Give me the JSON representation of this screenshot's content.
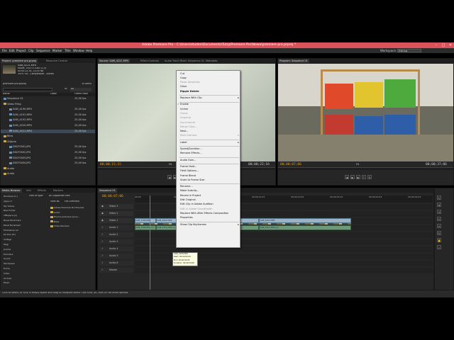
{
  "app": {
    "title": "Adobe Premiere Pro - C:\\Users\\studen\\Documents\\Tutaj\\Premiere Pro\\Nowa\\premiere pro.prproj *",
    "window_controls": [
      "–",
      "□",
      "✕"
    ],
    "workspace_label": "Workspace:",
    "workspace_value": "Editing"
  },
  "menu": [
    "File",
    "Edit",
    "Project",
    "Clip",
    "Sequence",
    "Marker",
    "Title",
    "Window",
    "Help"
  ],
  "project_panel": {
    "tabs": [
      "Project: premiere pro.prproj",
      "Resource Central"
    ],
    "clip_info": {
      "name": "SAM_4221.MP4",
      "line1": "Movie, 1920 x 1080 (1.0)",
      "line2": "00:00:22:16, 25,00 fps",
      "line3": "29.97 Hz - Compressed - Stereo"
    },
    "project_name": "premiere pro.prproj",
    "item_count": "30 Items",
    "search_placeholder": "",
    "in_label": "In:",
    "in_value": "All",
    "col_name": "Name",
    "col_label": "Label",
    "col_rate": "Frame Rate",
    "items": [
      {
        "name": "Sequence 01",
        "rate": "25,00 fps",
        "type": "seq"
      },
      {
        "name": "Video Filmy",
        "rate": "",
        "type": "folder"
      },
      {
        "name": "SAM_4190.MP4",
        "rate": "25,00 fps",
        "type": "clip"
      },
      {
        "name": "SAM_4191.MP4",
        "rate": "25,00 fps",
        "type": "clip"
      },
      {
        "name": "SAM_4192.MP4",
        "rate": "25,00 fps",
        "type": "clip"
      },
      {
        "name": "SAM_4220.MP4",
        "rate": "25,00 fps",
        "type": "clip"
      },
      {
        "name": "SAM_4221.MP4",
        "rate": "25,00 fps",
        "type": "clip"
      },
      {
        "name": "Biles",
        "rate": "",
        "type": "folder"
      },
      {
        "name": "Zdjęcia",
        "rate": "",
        "type": "folder"
      },
      {
        "name": "DSCF0001.JPG",
        "rate": "25,00 fps",
        "type": "clip"
      },
      {
        "name": "DSCF0002.JPG",
        "rate": "25,00 fps",
        "type": "clip"
      },
      {
        "name": "DSCF0003.JPG",
        "rate": "25,00 fps",
        "type": "clip"
      },
      {
        "name": "DSCF0004.JPG",
        "rate": "25,00 fps",
        "type": "clip"
      },
      {
        "name": "Audio",
        "rate": "",
        "type": "folder"
      },
      {
        "name": "Audio",
        "rate": "",
        "type": "folder"
      }
    ]
  },
  "source_monitor": {
    "tabs": [
      "Source: SAM_4221.MP4",
      "Effect Controls",
      "Audio Track Mixer: Sequence 01",
      "Metadata"
    ],
    "timecode_in": "00;00;15;15",
    "timecode_out": "00;00;22;16",
    "fit_label": "Fit"
  },
  "program_monitor": {
    "tabs": [
      "Program: Sequence 01"
    ],
    "timecode_in": "00;00;07;06",
    "timecode_out": "00;00;37;06",
    "fit_label": "Fit"
  },
  "media_browser": {
    "tabs": [
      "Media Browser",
      "Info",
      "Effects",
      "Markers"
    ],
    "files_of_type_label": "Files of type:",
    "files_of_type_value": "All Supported Files",
    "view_as_label": "View as:",
    "view_as_value": "File Directory",
    "tree": [
      "Windows (C:)",
      "Apps.rcr",
      "My Videos",
      "New Folder",
      "offtspace.prj",
      "Nowa Bookmark",
      "Panel Bookmark",
      "Photoshop Ad",
      "Sh Kick (E:)",
      "Solfege",
      "Targi",
      "Joomla",
      "Premiere",
      "Sound",
      "Wordpress",
      "Home",
      "Video",
      "Archive",
      "Music"
    ],
    "files": [
      "Adobe Premiere Pro Preview",
      "Audio",
      "Encore premiere pro.p...",
      "Biles",
      "Video Renders"
    ]
  },
  "timeline": {
    "tabs": [
      "Sequence 01"
    ],
    "timecode": "00;00;07;06",
    "ruler": [
      "00;00",
      "00;00;04;23",
      "00;00;09;23",
      "00;00;14;23",
      "00;00;19;23",
      "00;00;24;23",
      "00;00;29;23",
      "00;00;34;23"
    ],
    "tracks": [
      {
        "name": "Video 3",
        "kind": "video"
      },
      {
        "name": "Video 2",
        "kind": "video"
      },
      {
        "name": "Video 1",
        "kind": "video"
      },
      {
        "name": "Audio 1",
        "kind": "audio"
      },
      {
        "name": "Audio 2",
        "kind": "audio"
      },
      {
        "name": "Audio 3",
        "kind": "audio"
      },
      {
        "name": "Audio 4",
        "kind": "audio"
      },
      {
        "name": "Audio 5",
        "kind": "audio"
      },
      {
        "name": "Audio 6",
        "kind": "audio"
      },
      {
        "name": "Master",
        "kind": "audio"
      }
    ],
    "clips_v1": [
      "SAM_4190.MP4",
      "SAM_4221.MP4",
      "SAM_4192.MP4",
      "SAM_4220.MP4",
      "SAM_4221.MP4"
    ],
    "clips_a1": [
      "SAM_4190.MP4 [A]",
      "SAM_4221.MP4 [A]",
      "SAM_4192.MP4 [A]",
      "SAM_4220.MP4 [A]",
      "SAM_4221.MP4 [A]"
    ]
  },
  "context_menu": {
    "items": [
      {
        "label": "Cut",
        "state": "normal"
      },
      {
        "label": "Copy",
        "state": "normal"
      },
      {
        "label": "Paste Attributes",
        "state": "disabled"
      },
      {
        "label": "Clear",
        "state": "normal"
      },
      {
        "label": "Ripple Delete",
        "state": "bold"
      },
      {
        "sep": true
      },
      {
        "label": "Replace With Clip",
        "state": "submenu"
      },
      {
        "sep": true
      },
      {
        "label": "Enable",
        "state": "checked"
      },
      {
        "label": "Unlink",
        "state": "normal"
      },
      {
        "label": "Group",
        "state": "disabled"
      },
      {
        "label": "Ungroup",
        "state": "disabled"
      },
      {
        "label": "Synchronize",
        "state": "disabled"
      },
      {
        "label": "Merge Clips...",
        "state": "disabled"
      },
      {
        "label": "Nest...",
        "state": "normal"
      },
      {
        "label": "Multi-Camera",
        "state": "disabled-submenu"
      },
      {
        "sep": true
      },
      {
        "label": "Label",
        "state": "submenu"
      },
      {
        "sep": true
      },
      {
        "label": "Speed/Duration...",
        "state": "normal"
      },
      {
        "label": "Remove Effects...",
        "state": "normal"
      },
      {
        "sep": true
      },
      {
        "label": "Audio Gain...",
        "state": "normal"
      },
      {
        "sep": true
      },
      {
        "label": "Frame Hold...",
        "state": "normal"
      },
      {
        "label": "Field Options...",
        "state": "normal"
      },
      {
        "label": "Frame Blend",
        "state": "normal"
      },
      {
        "label": "Scale to Frame Size",
        "state": "normal"
      },
      {
        "sep": true
      },
      {
        "label": "Rename...",
        "state": "normal"
      },
      {
        "label": "Make Subclip...",
        "state": "normal"
      },
      {
        "label": "Reveal in Project",
        "state": "normal"
      },
      {
        "label": "Edit Original",
        "state": "normal"
      },
      {
        "label": "Edit Clip in Adobe Audition",
        "state": "normal"
      },
      {
        "label": "Edit in Adobe Soundbooth",
        "state": "disabled"
      },
      {
        "label": "Replace With After Effects Composition",
        "state": "normal"
      },
      {
        "label": "Properties",
        "state": "normal"
      },
      {
        "sep": true
      },
      {
        "label": "Show Clip Keyframes",
        "state": "submenu"
      }
    ]
  },
  "tooltip": {
    "lines": [
      "SAM_4190.MP4",
      "Start: 00;00;00;00",
      "End: 00;00;04;05",
      "Duration: 00;00;04;06"
    ]
  },
  "status": {
    "text": "Click to select, or click in empty space and drag to marquee select. Use Shift, Alt, and Ctrl for other options."
  },
  "colors": {
    "titlebar": "#d9525c",
    "timecode": "#f0a000",
    "video_clip": "#9bb3c4",
    "audio_clip": "#6f9a79",
    "playhead": "#e05050"
  }
}
